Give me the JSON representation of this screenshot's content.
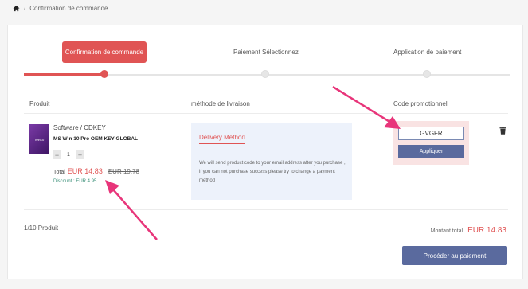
{
  "breadcrumb": {
    "current": "Confirmation de commande"
  },
  "steps": [
    {
      "label": "Confirmation de commande"
    },
    {
      "label": "Paiement Sélectionnez"
    },
    {
      "label": "Application de paiement"
    }
  ],
  "progress": {
    "current_step": 1,
    "total_steps": 3
  },
  "columns": {
    "product": "Produit",
    "delivery": "méthode de livraison",
    "promo": "Code promotionnel"
  },
  "product": {
    "category": "Software / CDKEY",
    "name": "MS Win 10 Pro OEM KEY GLOBAL",
    "thumb_text": "Win10",
    "quantity": "1",
    "total_label": "Total",
    "price": "EUR 14.83",
    "old_price": "EUR 19.78",
    "discount": "Discount : EUR 4.95"
  },
  "delivery": {
    "title": "Delivery Method",
    "description": "We will send product code to your email address after you purchase , if you can not purchase success please try to change a payment method"
  },
  "promo": {
    "code_value": "GVGFR",
    "apply_label": "Appliquer"
  },
  "summary": {
    "count": "1/10 Produit",
    "total_label": "Montant total",
    "total_value": "EUR 14.83",
    "checkout_label": "Procéder au paiement"
  },
  "colors": {
    "accent_red": "#e05454",
    "button_blue": "#5a6a9e",
    "annotation_arrow": "#e8357a"
  }
}
